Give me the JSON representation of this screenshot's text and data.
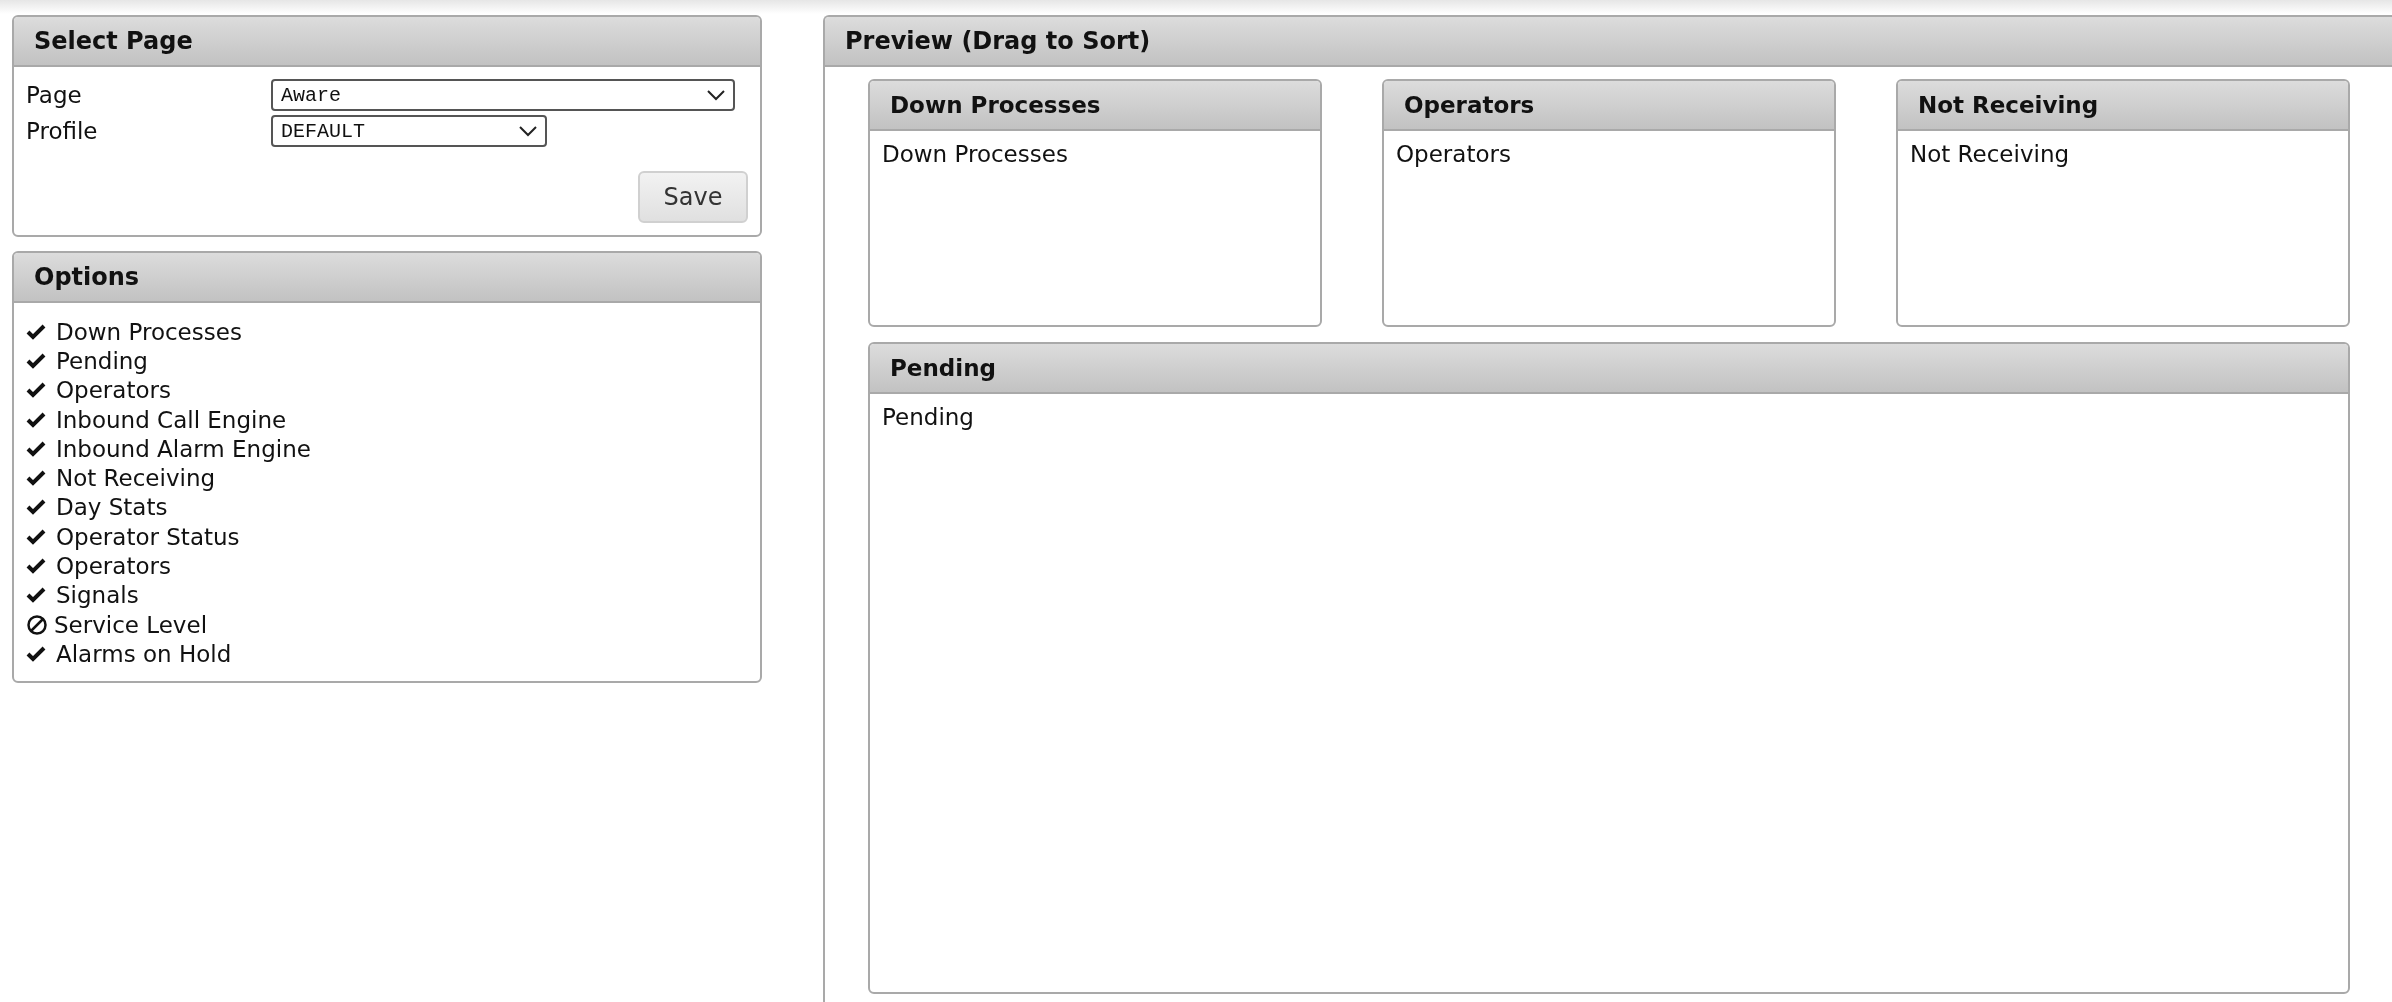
{
  "select_page": {
    "title": "Select Page",
    "fields": [
      {
        "label": "Page",
        "value": "Aware"
      },
      {
        "label": "Profile",
        "value": "DEFAULT"
      }
    ],
    "save_button": "Save"
  },
  "options": {
    "title": "Options",
    "items": [
      {
        "label": "Down Processes",
        "enabled": true
      },
      {
        "label": "Pending",
        "enabled": true
      },
      {
        "label": "Operators",
        "enabled": true
      },
      {
        "label": "Inbound Call Engine",
        "enabled": true
      },
      {
        "label": "Inbound Alarm Engine",
        "enabled": true
      },
      {
        "label": "Not Receiving",
        "enabled": true
      },
      {
        "label": "Day Stats",
        "enabled": true
      },
      {
        "label": "Operator Status",
        "enabled": true
      },
      {
        "label": "Operators",
        "enabled": true
      },
      {
        "label": "Signals",
        "enabled": true
      },
      {
        "label": "Service Level",
        "enabled": false
      },
      {
        "label": "Alarms on Hold",
        "enabled": true
      }
    ]
  },
  "preview": {
    "title": "Preview (Drag to Sort)",
    "rows": [
      [
        {
          "title": "Down Processes",
          "body": "Down Processes"
        },
        {
          "title": "Operators",
          "body": "Operators"
        },
        {
          "title": "Not Receiving",
          "body": "Not Receiving"
        }
      ],
      [
        {
          "title": "Pending",
          "body": "Pending"
        }
      ]
    ]
  }
}
